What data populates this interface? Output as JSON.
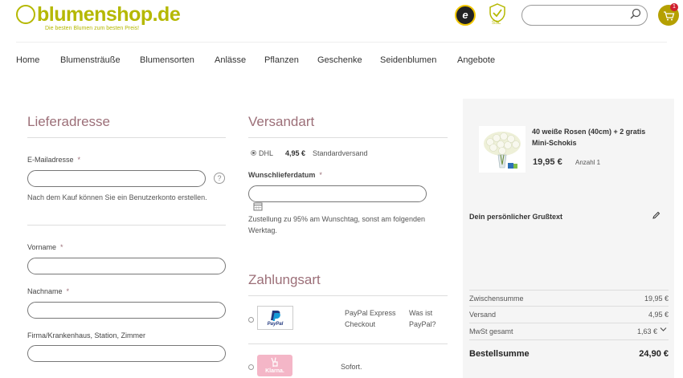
{
  "header": {
    "logo_text": "blumenshop.de",
    "tagline": "Die besten Blumen zum besten Preis!",
    "trust_badge": "e",
    "ssl_label": "SSL",
    "search_placeholder": "",
    "cart_count": "1"
  },
  "nav": [
    "Home",
    "Blumensträuße",
    "Blumensorten",
    "Anlässe",
    "Pflanzen",
    "Geschenke",
    "Seidenblumen",
    "Angebote"
  ],
  "lieferadresse": {
    "title": "Lieferadresse",
    "email_label": "E-Mailadresse",
    "required_mark": "*",
    "help": "?",
    "account_note": "Nach dem Kauf können Sie ein Benutzerkonto erstellen.",
    "vorname_label": "Vorname",
    "nachname_label": "Nachname",
    "firma_label": "Firma/Krankenhaus, Station, Zimmer"
  },
  "versandart": {
    "title": "Versandart",
    "carrier": "DHL",
    "price": "4,95 €",
    "method": "Standardversand",
    "date_label": "Wunschlieferdatum",
    "note": "Zustellung zu 95% am Wunschtag, sonst am folgenden Werktag."
  },
  "zahlungsart": {
    "title": "Zahlungsart",
    "paypal_label": "PayPal Express Checkout",
    "paypal_question": "Was ist PayPal?",
    "paypal_logo": "PayPal",
    "sofort_label": "Sofort.",
    "klarna_logo": "Klarna."
  },
  "summary": {
    "product_name": "40 weiße Rosen (40cm) + 2 gratis Mini-Schokis",
    "product_price": "19,95 €",
    "quantity": "Anzahl 1",
    "greeting_label": "Dein persönlicher Grußtext",
    "subtotal_label": "Zwischensumme",
    "subtotal": "19,95 €",
    "shipping_label": "Versand",
    "shipping": "4,95 €",
    "vat_label": "MwSt gesamt",
    "vat": "1,63 €",
    "total_label": "Bestellsumme",
    "total": "24,90 €"
  },
  "colors": {
    "brand": "#b5b800",
    "heading": "#9c6f78",
    "panel": "#f5f5f5"
  }
}
